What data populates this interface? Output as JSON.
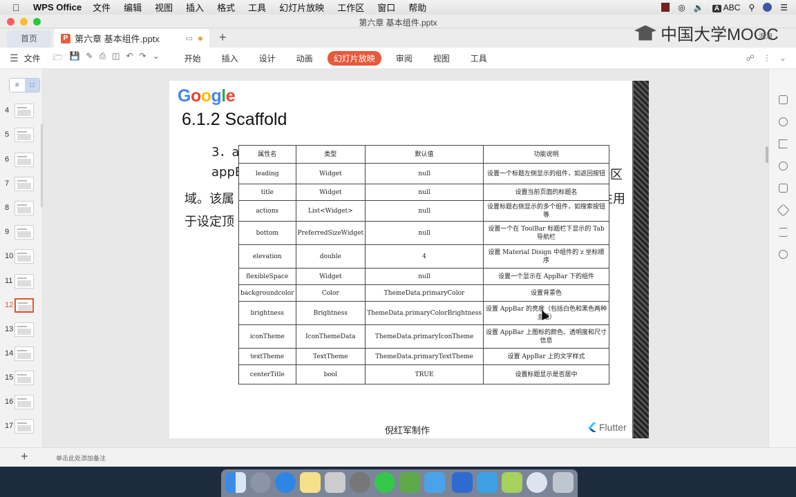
{
  "menubar": {
    "app_name": "WPS Office",
    "items": [
      "文件",
      "编辑",
      "视图",
      "插入",
      "格式",
      "工具",
      "幻灯片放映",
      "工作区",
      "窗口",
      "帮助"
    ],
    "input_method": "ABC"
  },
  "window": {
    "title": "第六章 基本组件.pptx"
  },
  "watermark": {
    "text": "中国大学MOOC",
    "sub": "泡泡"
  },
  "tabs": {
    "home": "首页",
    "doc": "第六章 基本组件.pptx",
    "doc_icon": "P"
  },
  "toolbar": {
    "file_label": "文件",
    "ribbon_tabs": [
      "开始",
      "插入",
      "设计",
      "动画",
      "幻灯片放映",
      "审阅",
      "视图",
      "工具"
    ],
    "active_tab": "幻灯片放映"
  },
  "slides_panel": {
    "numbers": [
      "4",
      "5",
      "6",
      "7",
      "8",
      "9",
      "10",
      "11",
      "12",
      "13",
      "14",
      "15",
      "16",
      "17"
    ],
    "active": "12"
  },
  "slide": {
    "logo": [
      "G",
      "o",
      "o",
      "g",
      "l",
      "e"
    ],
    "title": "6.1.2 Scaffold",
    "line1": "3．a",
    "line2_left": "appB",
    "line2_right": "的顶部区",
    "line3_left": "域。该属",
    "line3_right": "用属性用",
    "line4_left": "于设定顶",
    "footer": "倪红军制作",
    "flutter_label": "Flutter",
    "table": {
      "headers": [
        "属性名",
        "类型",
        "默认值",
        "功能说明"
      ],
      "rows": [
        [
          "leading",
          "Widget",
          "null",
          "设置一个标题左侧显示的组件，如返回按钮"
        ],
        [
          "title",
          "Widget",
          "null",
          "设置当前页面的标题名"
        ],
        [
          "actions",
          "List<Widget>",
          "null",
          "设置标题右侧显示的多个组件，如搜索按钮等"
        ],
        [
          "bottom",
          "PreferredSizeWidget",
          "null",
          "设置一个在 ToolBar 标题栏下显示的 Tab 导航栏"
        ],
        [
          "elevation",
          "double",
          "4",
          "设置 Material Disign 中组件的 z 坐标顺序"
        ],
        [
          "flexibleSpace",
          "Widget",
          "null",
          "设置一个显示在 AppBar 下的组件"
        ],
        [
          "backgroundcolor",
          "Color",
          "ThemeData.primaryColor",
          "设置背景色"
        ],
        [
          "brightness",
          "Brightness",
          "ThemeData.primaryColorBrightness",
          "设置 AppBar 的亮度（包括白色和黑色两种主题）"
        ],
        [
          "iconTheme",
          "IconThemeData",
          "ThemeData.primaryIconTheme",
          "设置 AppBar 上图标的颜色、透明度和尺寸信息"
        ],
        [
          "textTheme",
          "TextTheme",
          "ThemeData.primaryTextTheme",
          "设置 AppBar 上的文字样式"
        ],
        [
          "centerTitle",
          "bool",
          "TRUE",
          "设置标题显示是否居中"
        ]
      ]
    }
  },
  "statusbar": {
    "note_placeholder": "单击此处添加备注"
  },
  "colors": {
    "accent": "#e8593b",
    "active_slide": "#e0532c"
  }
}
